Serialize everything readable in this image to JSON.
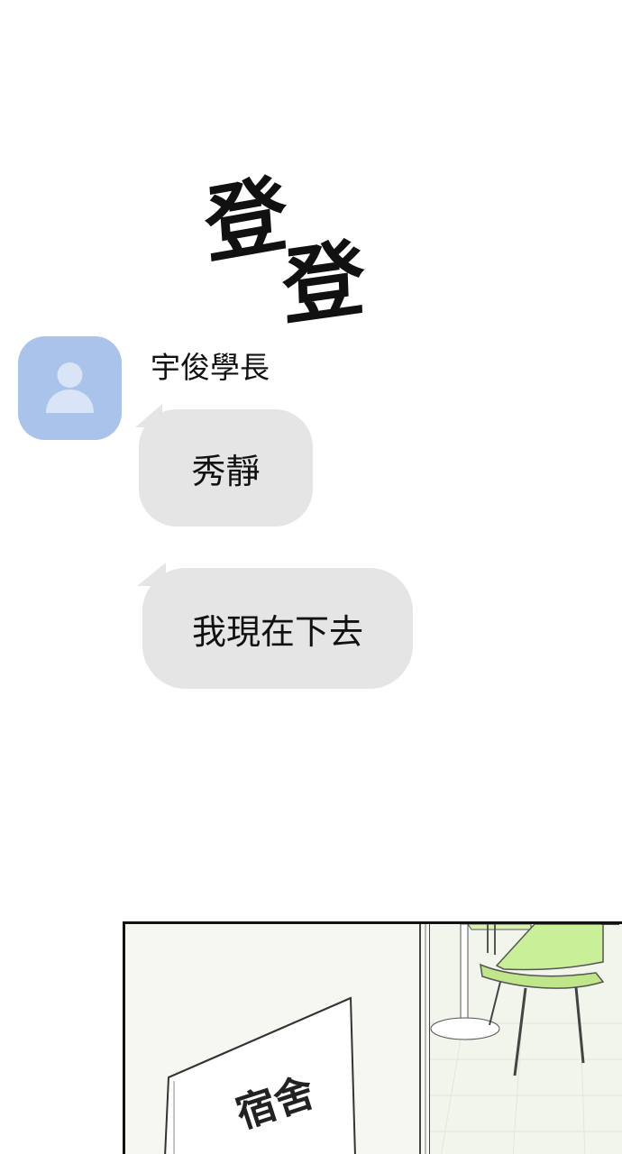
{
  "sound_effect": {
    "first": "登",
    "second": "登"
  },
  "chat": {
    "sender_name": "宇俊學長",
    "avatar_icon": "person-icon",
    "messages": [
      {
        "text": "秀靜"
      },
      {
        "text": "我現在下去"
      }
    ],
    "bubble_color": "#e5e5e5",
    "avatar_color": "#a9c3ea"
  },
  "scene": {
    "sign_text": "宿舍",
    "chair_color": "#c9ef98"
  }
}
